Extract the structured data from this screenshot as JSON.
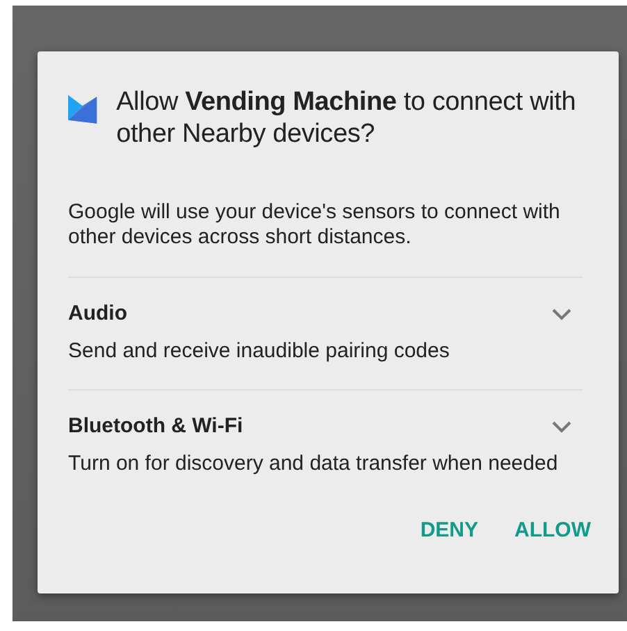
{
  "dialog": {
    "title": "Allow **Vending Machine** to connect with other Nearby devices?",
    "description": "Google will use your device's sensors to connect with other devices across short distances.",
    "sections": [
      {
        "title": "Audio",
        "description": "Send and receive inaudible pairing codes",
        "expanded": false
      },
      {
        "title": "Bluetooth & Wi-Fi",
        "description": "Turn on for discovery and data transfer when needed",
        "expanded": false
      }
    ],
    "buttons": [
      "DENY",
      "ALLOW"
    ]
  }
}
